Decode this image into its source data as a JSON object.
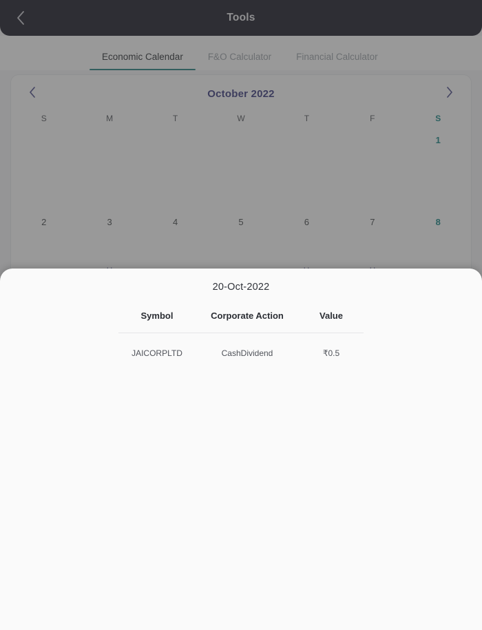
{
  "appbar": {
    "title": "Tools",
    "back_icon": "chevron-left-icon",
    "background": "#12121f",
    "title_color": "#e8e8ec"
  },
  "tabs": {
    "items": [
      {
        "label": "Economic Calendar",
        "active": true
      },
      {
        "label": "F&O Calculator",
        "active": false
      },
      {
        "label": "Financial Calculator",
        "active": false
      }
    ],
    "active_color": "#23262b",
    "inactive_color": "#9aa0a6",
    "indicator_color": "#1c7a7a"
  },
  "calendar": {
    "month_label": "October 2022",
    "month_color": "#33337a",
    "prev_icon": "chevron-left-icon",
    "next_icon": "chevron-right-icon",
    "weekdays": [
      {
        "label": "S",
        "weekend": false
      },
      {
        "label": "M",
        "weekend": false
      },
      {
        "label": "T",
        "weekend": false
      },
      {
        "label": "W",
        "weekend": false
      },
      {
        "label": "T",
        "weekend": false
      },
      {
        "label": "F",
        "weekend": false
      },
      {
        "label": "S",
        "weekend": true
      }
    ],
    "weekend_color": "#0f8080",
    "event_icon": "calendar-check-icon",
    "event_icon_color": "#4a4f8c",
    "days": [
      {
        "num": "",
        "empty": true,
        "weekend": false,
        "event": false
      },
      {
        "num": "",
        "empty": true,
        "weekend": false,
        "event": false
      },
      {
        "num": "",
        "empty": true,
        "weekend": false,
        "event": false
      },
      {
        "num": "",
        "empty": true,
        "weekend": false,
        "event": false
      },
      {
        "num": "",
        "empty": true,
        "weekend": false,
        "event": false
      },
      {
        "num": "",
        "empty": true,
        "weekend": false,
        "event": false
      },
      {
        "num": "1",
        "empty": false,
        "weekend": true,
        "event": false
      },
      {
        "num": "2",
        "empty": false,
        "weekend": false,
        "event": false
      },
      {
        "num": "3",
        "empty": false,
        "weekend": false,
        "event": true
      },
      {
        "num": "4",
        "empty": false,
        "weekend": false,
        "event": false
      },
      {
        "num": "5",
        "empty": false,
        "weekend": false,
        "event": false
      },
      {
        "num": "6",
        "empty": false,
        "weekend": false,
        "event": true
      },
      {
        "num": "7",
        "empty": false,
        "weekend": false,
        "event": true
      },
      {
        "num": "8",
        "empty": false,
        "weekend": true,
        "event": false
      }
    ]
  },
  "sheet": {
    "title": "20-Oct-2022",
    "columns": [
      "Symbol",
      "Corporate Action",
      "Value"
    ],
    "rows": [
      {
        "symbol": "JAICORPLTD",
        "action": "CashDividend",
        "value": "₹0.5"
      }
    ]
  }
}
